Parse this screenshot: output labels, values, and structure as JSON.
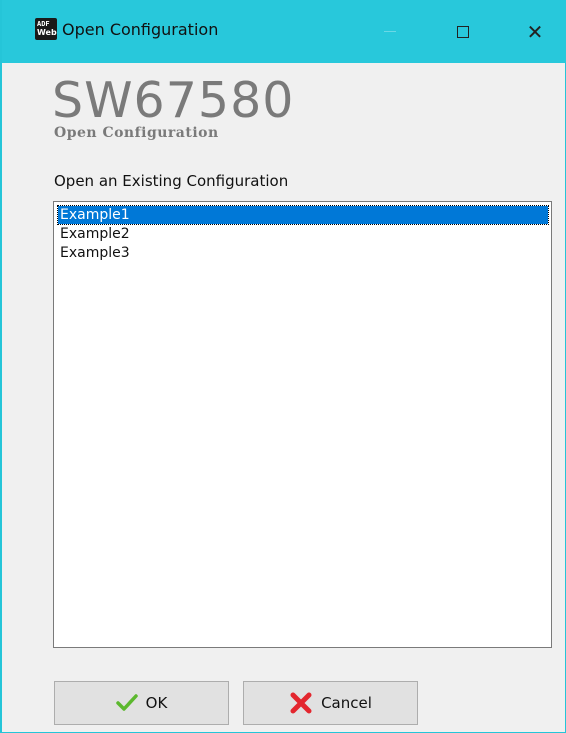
{
  "window": {
    "title": "Open Configuration",
    "icon_top": "ADF",
    "icon_bottom": "Web"
  },
  "header": {
    "product_code": "SW67580",
    "subtitle": "Open  Configuration"
  },
  "main": {
    "section_label": "Open an Existing Configuration",
    "configurations": [
      "Example1",
      "Example2",
      "Example3"
    ],
    "selected_index": 0
  },
  "buttons": {
    "ok_label": "OK",
    "cancel_label": "Cancel"
  },
  "icons": {
    "ok": "checkmark-icon",
    "cancel": "red-x-icon",
    "app": "adfweb-icon",
    "minimize": "minimize-icon",
    "maximize": "maximize-icon",
    "close": "close-icon"
  },
  "colors": {
    "titlebar": "#28c8db",
    "selection": "#0078d7",
    "brand_gray": "#7a7a7a",
    "check_green": "#5cb82e",
    "cancel_red": "#e3262e"
  }
}
